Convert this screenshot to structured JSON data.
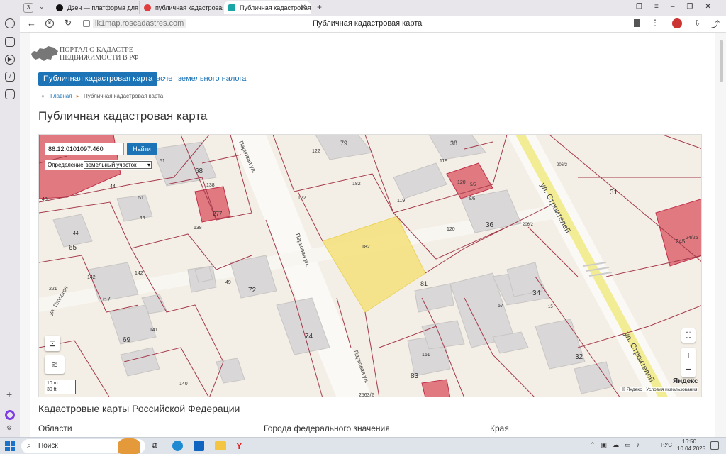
{
  "browser": {
    "tab_count": "3",
    "tabs": [
      {
        "label": "Дзен — платформа для п",
        "color": "#111111"
      },
      {
        "label": "публичная кадастровая к",
        "color": "#e23d3d"
      },
      {
        "label": "Публичная кадастровая карта",
        "color": "#1aa6a6"
      }
    ],
    "url": "lk1map.roscadastres.com",
    "page_title": "Публичная кадастровая карта"
  },
  "header": {
    "logo_line1": "ПОРТАЛ О КАДАСТРЕ",
    "logo_line2": "НЕДВИЖИМОСТИ В РФ"
  },
  "nav": {
    "active": "Публичная кадастровая карта",
    "other": "Расчет земельного налога"
  },
  "breadcrumb": {
    "home": "Главная",
    "current": "Публичная кадастровая карта"
  },
  "main": {
    "title": "Публичная кадастровая карта",
    "section_title": "Кадастровые карты Российской Федерации",
    "columns": [
      "Области",
      "Города федерального значения",
      "Края"
    ]
  },
  "map": {
    "search_value": "86:12:0101097:460",
    "search_button": "Найти",
    "define_label": "Определение",
    "define_option": "земельный участок",
    "scale_m": "10 m",
    "scale_ft": "30 ft",
    "yandex_logo": "Яндекс",
    "copyright": "© Яндекс",
    "terms": "Условия использования",
    "streets": [
      "Парковая ул.",
      "Парковая ул.",
      "Парковая ул.",
      "ул. Строителей",
      "ул. Строителей",
      "ул. Геологов"
    ],
    "labels": [
      {
        "t": "79"
      },
      {
        "t": "38"
      },
      {
        "t": "122"
      },
      {
        "t": "119"
      },
      {
        "t": "68"
      },
      {
        "t": "51"
      },
      {
        "t": "43"
      },
      {
        "t": "44"
      },
      {
        "t": "138"
      },
      {
        "t": "51"
      },
      {
        "t": "277"
      },
      {
        "t": "138"
      },
      {
        "t": "122"
      },
      {
        "t": "182"
      },
      {
        "t": "119"
      },
      {
        "t": "120"
      },
      {
        "t": "5/5"
      },
      {
        "t": "5/5"
      },
      {
        "t": "206/2"
      },
      {
        "t": "31"
      },
      {
        "t": "36"
      },
      {
        "t": "120"
      },
      {
        "t": "206/2"
      },
      {
        "t": "44"
      },
      {
        "t": "65"
      },
      {
        "t": "44"
      },
      {
        "t": "182"
      },
      {
        "t": "142"
      },
      {
        "t": "142"
      },
      {
        "t": "67"
      },
      {
        "t": "221"
      },
      {
        "t": "49"
      },
      {
        "t": "72"
      },
      {
        "t": "81"
      },
      {
        "t": "34"
      },
      {
        "t": "57"
      },
      {
        "t": "15"
      },
      {
        "t": "141"
      },
      {
        "t": "69"
      },
      {
        "t": "74"
      },
      {
        "t": "161"
      },
      {
        "t": "83"
      },
      {
        "t": "32"
      },
      {
        "t": "140"
      },
      {
        "t": "2563/2"
      },
      {
        "t": "245"
      },
      {
        "t": "24/26"
      }
    ]
  },
  "taskbar": {
    "search": "Поиск",
    "lang": "РУС",
    "time": "16:50",
    "date": "10.04.2025"
  }
}
